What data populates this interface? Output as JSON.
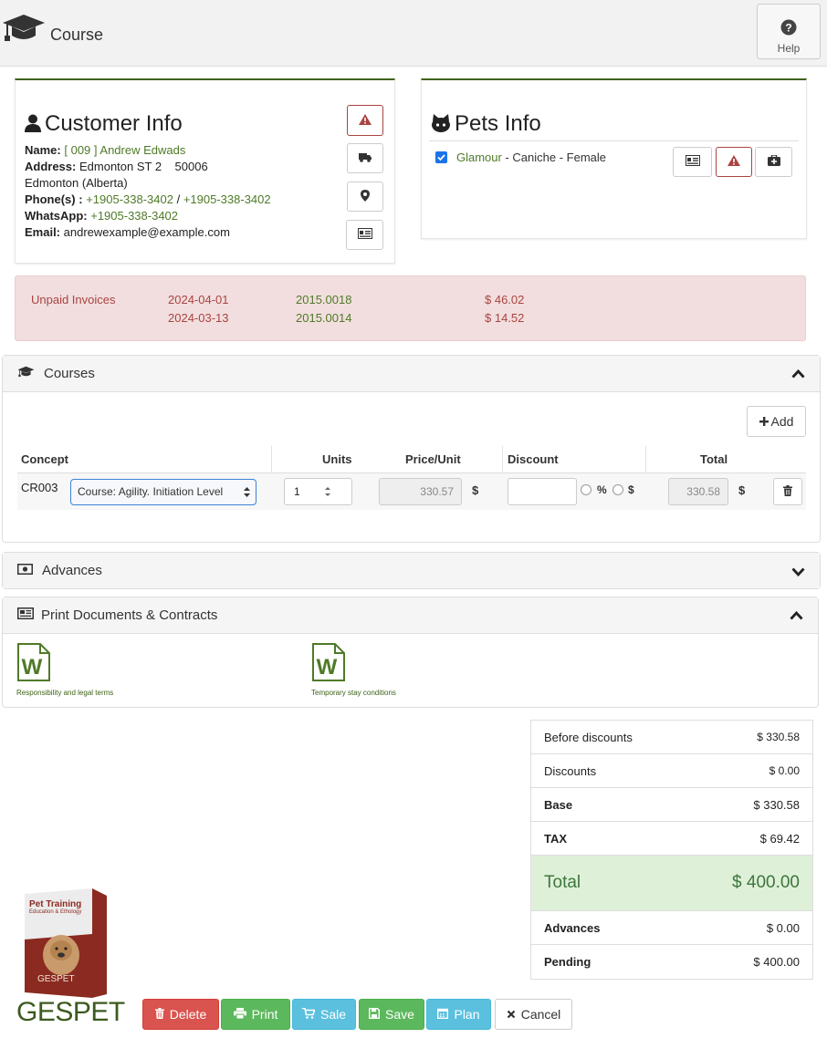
{
  "header": {
    "title": "Course",
    "help_label": "Help"
  },
  "customer": {
    "heading": "Customer Info",
    "name_label": "Name:",
    "name_value": "[ 009 ] Andrew Edwads",
    "address_label": "Address:",
    "address_value": "Edmonton ST 2    50006",
    "address_line2": "Edmonton (Alberta)",
    "phones_label": "Phone(s) :",
    "phone1": "+1905-338-3402",
    "phone_sep": "/",
    "phone2": "+1905-338-3402",
    "whatsapp_label": "WhatsApp:",
    "whatsapp_value": "+1905-338-3402",
    "email_label": "Email:",
    "email_value": "andrewexample@example.com"
  },
  "pets": {
    "heading": "Pets Info",
    "pet_name": "Glamour",
    "pet_details": " - Caniche - Female",
    "checked": true
  },
  "unpaid": {
    "label": "Unpaid Invoices",
    "rows": [
      {
        "date": "2024-04-01",
        "number": "2015.0018",
        "amount": "$ 46.02"
      },
      {
        "date": "2024-03-13",
        "number": "2015.0014",
        "amount": "$ 14.52"
      }
    ]
  },
  "courses": {
    "title": "Courses",
    "add_label": "Add",
    "columns": {
      "concept": "Concept",
      "units": "Units",
      "price": "Price/Unit",
      "discount": "Discount",
      "total": "Total"
    },
    "row": {
      "code": "CR003",
      "course": "Course: Agility. Initiation Level",
      "units": "1",
      "price": "330.57",
      "currency": "$",
      "percent": "%",
      "dollar": "$",
      "total": "330.58"
    }
  },
  "advances": {
    "title": "Advances"
  },
  "print_docs": {
    "title": "Print Documents & Contracts",
    "docs": [
      {
        "label": "Responsibility and legal terms"
      },
      {
        "label": "Temporary stay conditions"
      }
    ]
  },
  "totals": {
    "before_discounts_label": "Before discounts",
    "before_discounts": "$ 330.58",
    "discounts_label": "Discounts",
    "discounts": "$ 0.00",
    "base_label": "Base",
    "base": "$ 330.58",
    "tax_label": "TAX",
    "tax": "$ 69.42",
    "total_label": "Total",
    "total": "$ 400.00",
    "advances_label": "Advances",
    "advances": "$ 0.00",
    "pending_label": "Pending",
    "pending": "$ 400.00"
  },
  "branding": {
    "box_title": "Pet Training",
    "box_subtitle": "Education & Ethology",
    "box_logo": "GESPET",
    "logo": "GESPET"
  },
  "buttons": {
    "delete": "Delete",
    "print": "Print",
    "sale": "Sale",
    "save": "Save",
    "plan": "Plan",
    "cancel": "Cancel"
  },
  "colors": {
    "accent_green": "#4f7a28",
    "danger": "#d9534f",
    "success": "#5cb85c",
    "info": "#5bc0de",
    "alert_bg": "#f2dede",
    "total_bg": "#dff0d8"
  }
}
